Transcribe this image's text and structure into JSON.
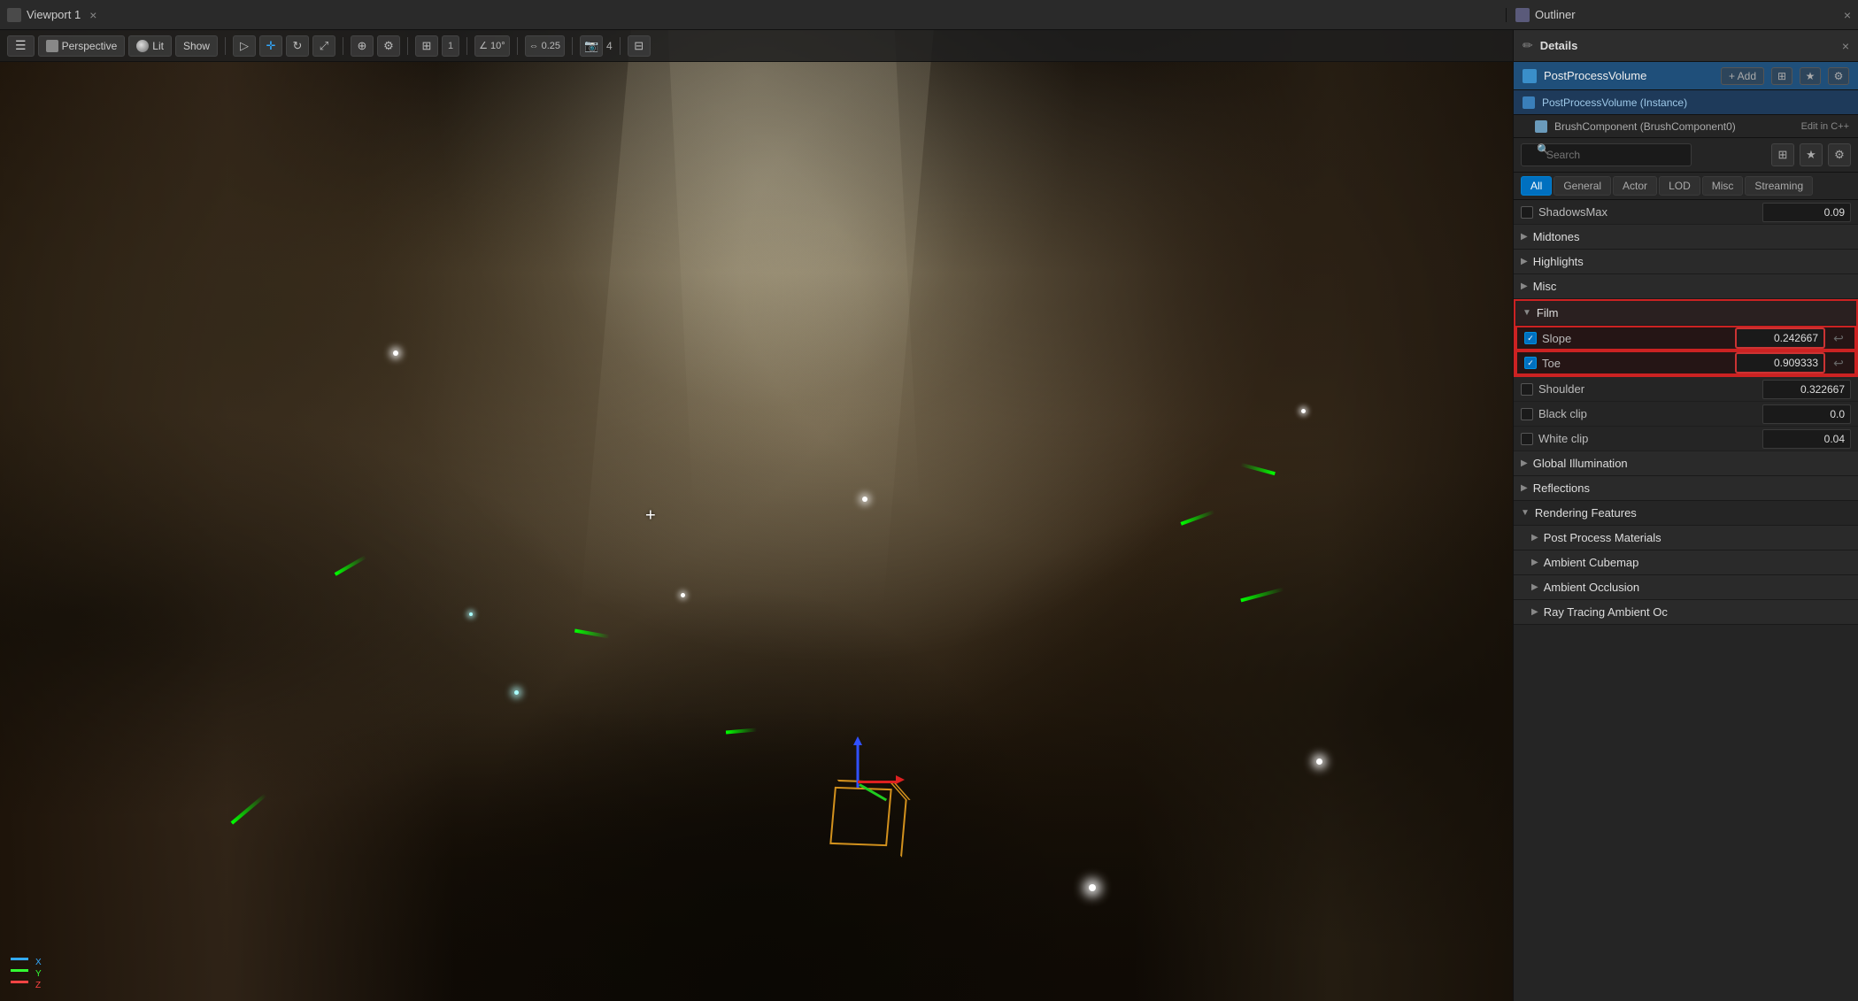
{
  "titlebar": {
    "viewport_title": "Viewport 1",
    "close_label": "×",
    "outliner_title": "Outliner"
  },
  "viewport": {
    "perspective_label": "Perspective",
    "lit_label": "Lit",
    "show_label": "Show",
    "angle_value": "10°",
    "scale_value": "0.25",
    "layers_value": "4",
    "crosshair": "+",
    "coords": ""
  },
  "toolbar_icons": {
    "select": "▷",
    "move": "✛",
    "rotate": "↻",
    "scale": "⤢",
    "world": "⊕",
    "snap": "⚙",
    "grid": "⊞",
    "camera_angle": "📐",
    "camera_scale": "🔍",
    "layers": "⊡",
    "view_options": "⊟"
  },
  "details": {
    "title": "Details",
    "close_label": "×",
    "component_name": "PostProcessVolume",
    "add_label": "+ Add",
    "instance_label": "PostProcessVolume (Instance)",
    "brush_label": "BrushComponent (BrushComponent0)",
    "edit_cpp_label": "Edit in C++"
  },
  "search": {
    "placeholder": "Search",
    "layout_icon": "⊞",
    "star_icon": "★",
    "settings_icon": "⚙"
  },
  "category_tabs": {
    "tabs": [
      "General",
      "Actor",
      "LOD",
      "Misc",
      "Streaming"
    ],
    "active_tab": "All",
    "all_label": "All"
  },
  "properties": {
    "shadows_max_label": "ShadowsMax",
    "shadows_max_value": "0.09",
    "midtones_label": "Midtones",
    "highlights_label": "Highlights",
    "misc_label": "Misc",
    "film_label": "Film",
    "slope_label": "Slope",
    "slope_value": "0.242667",
    "slope_checked": true,
    "toe_label": "Toe",
    "toe_value": "0.909333",
    "toe_checked": true,
    "shoulder_label": "Shoulder",
    "shoulder_value": "0.322667",
    "shoulder_checked": false,
    "black_clip_label": "Black clip",
    "black_clip_value": "0.0",
    "black_clip_checked": false,
    "white_clip_label": "White clip",
    "white_clip_value": "0.04",
    "white_clip_checked": false,
    "global_illumination_label": "Global Illumination",
    "reflections_label": "Reflections",
    "rendering_features_label": "Rendering Features",
    "post_process_materials_label": "Post Process Materials",
    "ambient_cubemap_label": "Ambient Cubemap",
    "ambient_occlusion_label": "Ambient Occlusion",
    "ray_tracing_label": "Ray Tracing Ambient Oc"
  }
}
